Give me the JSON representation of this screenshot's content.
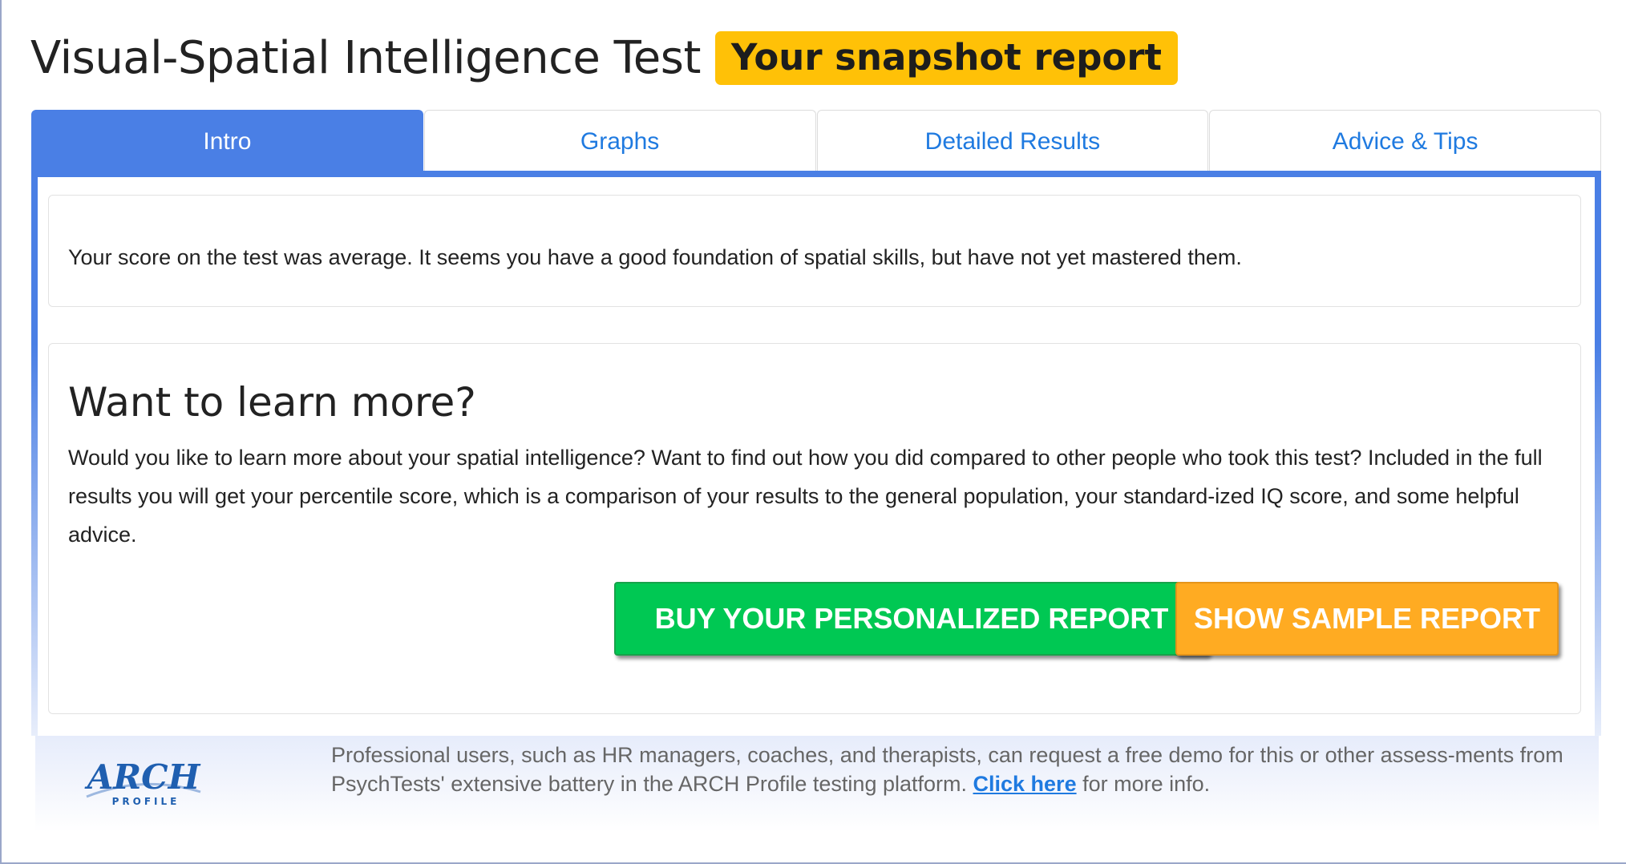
{
  "header": {
    "title": "Visual-Spatial Intelligence Test",
    "badge": "Your snapshot report"
  },
  "tabs": [
    {
      "label": "Intro",
      "active": true
    },
    {
      "label": "Graphs",
      "active": false
    },
    {
      "label": "Detailed Results",
      "active": false
    },
    {
      "label": "Advice & Tips",
      "active": false
    }
  ],
  "summary": {
    "text": "Your score on the test was average. It seems you have a good foundation of spatial skills, but have not yet mastered them."
  },
  "learn_more": {
    "heading": "Want to learn more?",
    "body": "Would you like to learn more about your spatial intelligence? Want to find out how you did compared to other people who took this test? Included in the full results you will get your percentile score, which is a comparison of your results to the general population, your standard-ized IQ score, and some helpful advice.",
    "buy_label": "BUY YOUR PERSONALIZED REPORT",
    "sample_label": "SHOW SAMPLE REPORT"
  },
  "footer": {
    "logo_text": "ARCH",
    "logo_sub": "PROFILE",
    "text_before": "Professional users, such as HR managers, coaches, and therapists, can request a free demo for this or other assess-ments from PsychTests' extensive battery in the ARCH Profile testing platform.",
    "link_label": "Click here",
    "text_after": "for more info."
  },
  "colors": {
    "accent": "#4a7fe5",
    "badge": "#ffc107",
    "buy": "#00c853",
    "sample": "#ffab22",
    "link": "#1f7ae0"
  }
}
